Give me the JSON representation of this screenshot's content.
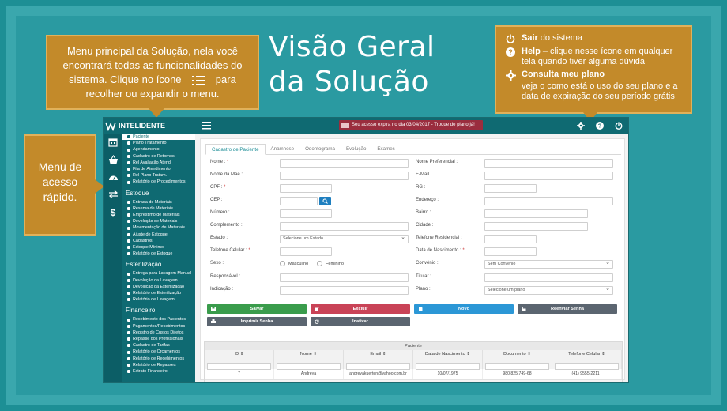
{
  "headline": {
    "line1": "Visão Geral",
    "line2": "da Solução"
  },
  "callouts": {
    "main_menu": {
      "text_before": "Menu principal da Solução, nela você encontrará todas as funcionalidades do sistema. Clique no ícone",
      "text_after": "para recolher ou expandir o menu."
    },
    "quick_access": {
      "text": "Menu de acesso rápido."
    },
    "help": {
      "logout_title": "Sair",
      "logout_text": "do sistema",
      "help_title": "Help",
      "help_text": "– clique nesse ícone em qualquer tela quando tiver alguma dúvida",
      "plan_title": "Consulta meu plano",
      "plan_text": "veja o como está o uso do seu plano e a data de expiração do seu período grátis"
    }
  },
  "app": {
    "logo_text": "INTELIDENTE",
    "banner": "Seu acesso expira no dia 03/04/2017 - Troque de plano já!",
    "sidebar": {
      "cadastros": [
        "Paciente",
        "Plano Tratamento",
        "Agendamento",
        "Cadastro de Retornos",
        "Rel Avaliação Atend.",
        "Fila de Atendimento",
        "Rel Plano Tratam.",
        "Relatório de Procedimentos"
      ],
      "estoque_title": "Estoque",
      "estoque": [
        "Entrada de Materiais",
        "Reserva de Materiais",
        "Empréstimo de Materiais",
        "Devolução de Materiais",
        "Movimentação de Materiais",
        "Ajuste de Estoque",
        "Cadastros",
        "Estoque Mínimo",
        "Relatório de Estoque"
      ],
      "esterilizacao_title": "Esterilização",
      "esterilizacao": [
        "Entrega para Lavagem Manual",
        "Devolução da Lavagem",
        "Devolução da Esterilização",
        "Relatório de Esterilização",
        "Relatório de Lavagem"
      ],
      "financeiro_title": "Financeiro",
      "financeiro": [
        "Recebimento dos Pacientes",
        "Pagamentos/Recebimentos",
        "Registro de Custos Diretos",
        "Repasse dos Profissionais",
        "Cadastro de Tarifas",
        "Relatório de Orçamentos",
        "Relatório de Recebimentos",
        "Relatório de Repasses",
        "Extrato Financeiro"
      ]
    },
    "tabs": [
      "Cadastro de Paciente",
      "Anamnese",
      "Odontograma",
      "Evolução",
      "Exames"
    ],
    "form": {
      "left_labels": {
        "nome": "Nome :",
        "nome_mae": "Nome da Mãe :",
        "cpf": "CPF :",
        "cep": "CEP :",
        "numero": "Número :",
        "complemento": "Complemento :",
        "estado": "Estado :",
        "telefone_celular": "Telefone Celular :",
        "sexo": "Sexo :",
        "responsavel": "Responsável :",
        "indicacao": "Indicação :"
      },
      "right_labels": {
        "nome_preferencial": "Nome Preferencial :",
        "email": "E-Mail :",
        "rg": "RG :",
        "endereco": "Endereço :",
        "bairro": "Bairro :",
        "cidade": "Cidade :",
        "telefone_residencial": "Telefone Residencial :",
        "data_nascimento": "Data de Nascimento :",
        "convenio": "Convênio :",
        "titular": "Titular :",
        "plano": "Plano :"
      },
      "required_mark": "*",
      "estado_value": "Selecione um Estado",
      "sexo_options": [
        "Masculino",
        "Feminino"
      ],
      "convenio_value": "Sem Convênio",
      "plano_value": "Selecione um plano"
    },
    "buttons": {
      "salvar": "Salvar",
      "excluir": "Excluir",
      "novo": "Novo",
      "reenviar_senha": "Reenviar Senha",
      "imprimir_senha": "Imprimir Senha",
      "inativar": "Inativar"
    },
    "table": {
      "title": "Paciente",
      "columns": [
        "ID",
        "Nome",
        "Email",
        "Data de Nascimento",
        "Documento",
        "Telefone Celular"
      ],
      "rows": [
        [
          "7",
          "Andreya",
          "andreyakuerten@yahoo.com.br",
          "10/07/1975",
          "980.825.749-68",
          "(41) 9555-2211_"
        ]
      ]
    }
  },
  "colors": {
    "teal_bg": "#1d8f95",
    "callout": "#c38a2a",
    "app_header": "#0f6a72",
    "banner": "#9a2d3e"
  }
}
